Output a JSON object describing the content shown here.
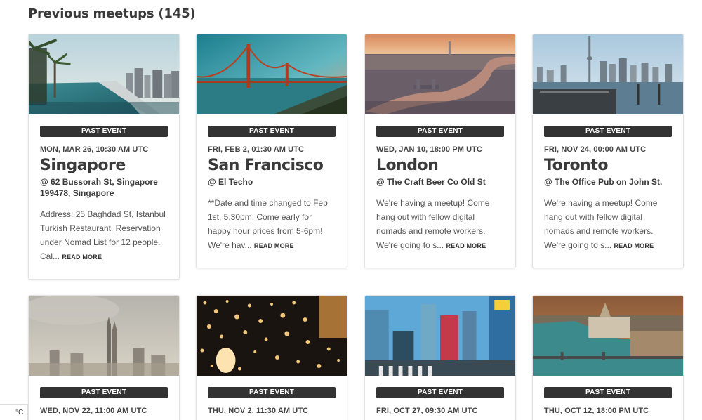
{
  "section": {
    "title": "Previous meetups (145)"
  },
  "cards": [
    {
      "badge": "PAST EVENT",
      "date": "MON, MAR 26, 10:30 AM UTC",
      "city": "Singapore",
      "venue": "@ 62 Bussorah St, Singapore 199478, Singapore",
      "description": "Address: 25 Baghdad St, Istanbul Turkish Restaurant. Reservation under Nomad List for 12 people. Cal...",
      "read_more": "READ MORE",
      "image": "singapore-infinity-pool-skyline"
    },
    {
      "badge": "PAST EVENT",
      "date": "FRI, FEB 2, 01:30 AM UTC",
      "city": "San Francisco",
      "venue": "@ El Techo",
      "description": "**Date and time changed to Feb 1st, 5.30pm. Come early for happy hour prices from 5-6pm! We're hav...",
      "read_more": "READ MORE",
      "image": "golden-gate-bridge"
    },
    {
      "badge": "PAST EVENT",
      "date": "WED, JAN 10, 18:00 PM UTC",
      "city": "London",
      "venue": "@ The Craft Beer Co Old St",
      "description": "We're having a meetup! Come hang out with fellow digital nomads and remote workers. We're going to s...",
      "read_more": "READ MORE",
      "image": "london-thames-aerial"
    },
    {
      "badge": "PAST EVENT",
      "date": "FRI, NOV 24, 00:00 AM UTC",
      "city": "Toronto",
      "venue": "@ The Office Pub on John St.",
      "description": "We're having a meetup! Come hang out with fellow digital nomads and remote workers. We're going to s...",
      "read_more": "READ MORE",
      "image": "toronto-skyline"
    },
    {
      "badge": "PAST EVENT",
      "date": "WED, NOV 22, 11:00 AM UTC",
      "image": "misty-skyscraper-city"
    },
    {
      "badge": "PAST EVENT",
      "date": "THU, NOV 2, 11:30 AM UTC",
      "image": "sky-lanterns-night"
    },
    {
      "badge": "PAST EVENT",
      "date": "FRI, OCT 27, 09:30 AM UTC",
      "image": "tokyo-shibuya-crossing"
    },
    {
      "badge": "PAST EVENT",
      "date": "THU, OCT 12, 18:00 PM UTC",
      "image": "budapest-parliament-river"
    }
  ],
  "unit_toggle": {
    "label": "°C"
  },
  "colors": {
    "badge_bg": "#333333",
    "card_border": "#e3e3e3",
    "heading": "#3a3a3a"
  }
}
